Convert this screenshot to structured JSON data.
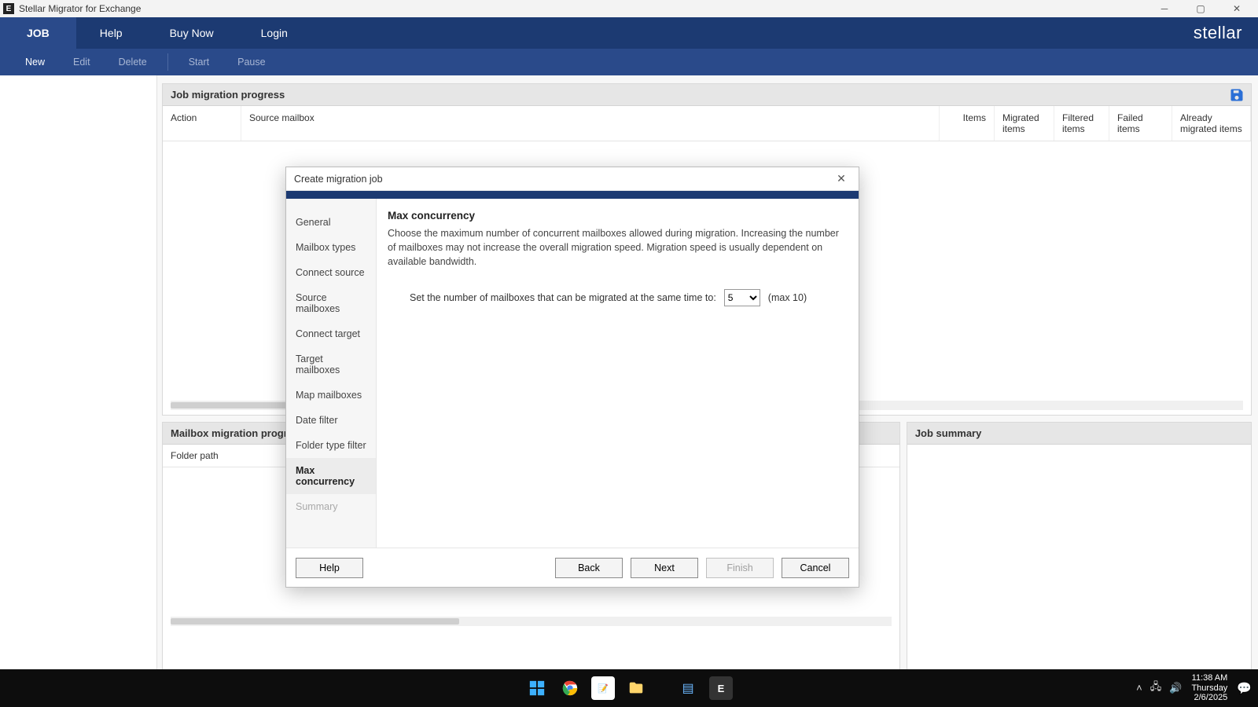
{
  "window": {
    "title": "Stellar Migrator for Exchange",
    "app_icon_letter": "E"
  },
  "brand": "stellar",
  "menubar": {
    "tabs": [
      "JOB",
      "Help",
      "Buy Now",
      "Login"
    ],
    "active_index": 0
  },
  "ribbon": {
    "items": [
      {
        "label": "New",
        "enabled": true
      },
      {
        "label": "Edit",
        "enabled": false
      },
      {
        "label": "Delete",
        "enabled": false
      },
      {
        "label": "Start",
        "enabled": false
      },
      {
        "label": "Pause",
        "enabled": false
      }
    ]
  },
  "panels": {
    "job_progress_title": "Job migration progress",
    "mailbox_progress_title": "Mailbox migration progress",
    "job_summary_title": "Job summary",
    "job_columns": [
      "Action",
      "Source mailbox",
      "Items",
      "Migrated items",
      "Filtered items",
      "Failed items",
      "Already migrated items"
    ],
    "mailbox_columns": [
      "Folder path"
    ]
  },
  "modal": {
    "title": "Create migration job",
    "nav": [
      {
        "label": "General",
        "state": "normal"
      },
      {
        "label": "Mailbox types",
        "state": "normal"
      },
      {
        "label": "Connect source",
        "state": "normal"
      },
      {
        "label": "Source mailboxes",
        "state": "normal"
      },
      {
        "label": "Connect target",
        "state": "normal"
      },
      {
        "label": "Target mailboxes",
        "state": "normal"
      },
      {
        "label": "Map mailboxes",
        "state": "normal"
      },
      {
        "label": "Date filter",
        "state": "normal"
      },
      {
        "label": "Folder type filter",
        "state": "normal"
      },
      {
        "label": "Max concurrency",
        "state": "active"
      },
      {
        "label": "Summary",
        "state": "disabled"
      }
    ],
    "content": {
      "heading": "Max concurrency",
      "description": "Choose the maximum number of concurrent mailboxes allowed during migration. Increasing the number of mailboxes may not increase the overall migration speed. Migration speed is usually dependent on available bandwidth.",
      "setting_label": "Set the number of mailboxes that can be migrated at the same time to:",
      "value": "5",
      "max_note": "(max 10)"
    },
    "buttons": {
      "help": "Help",
      "back": "Back",
      "next": "Next",
      "finish": "Finish",
      "cancel": "Cancel"
    }
  },
  "taskbar": {
    "time": "11:38 AM",
    "day": "Thursday",
    "date": "2/6/2025"
  }
}
